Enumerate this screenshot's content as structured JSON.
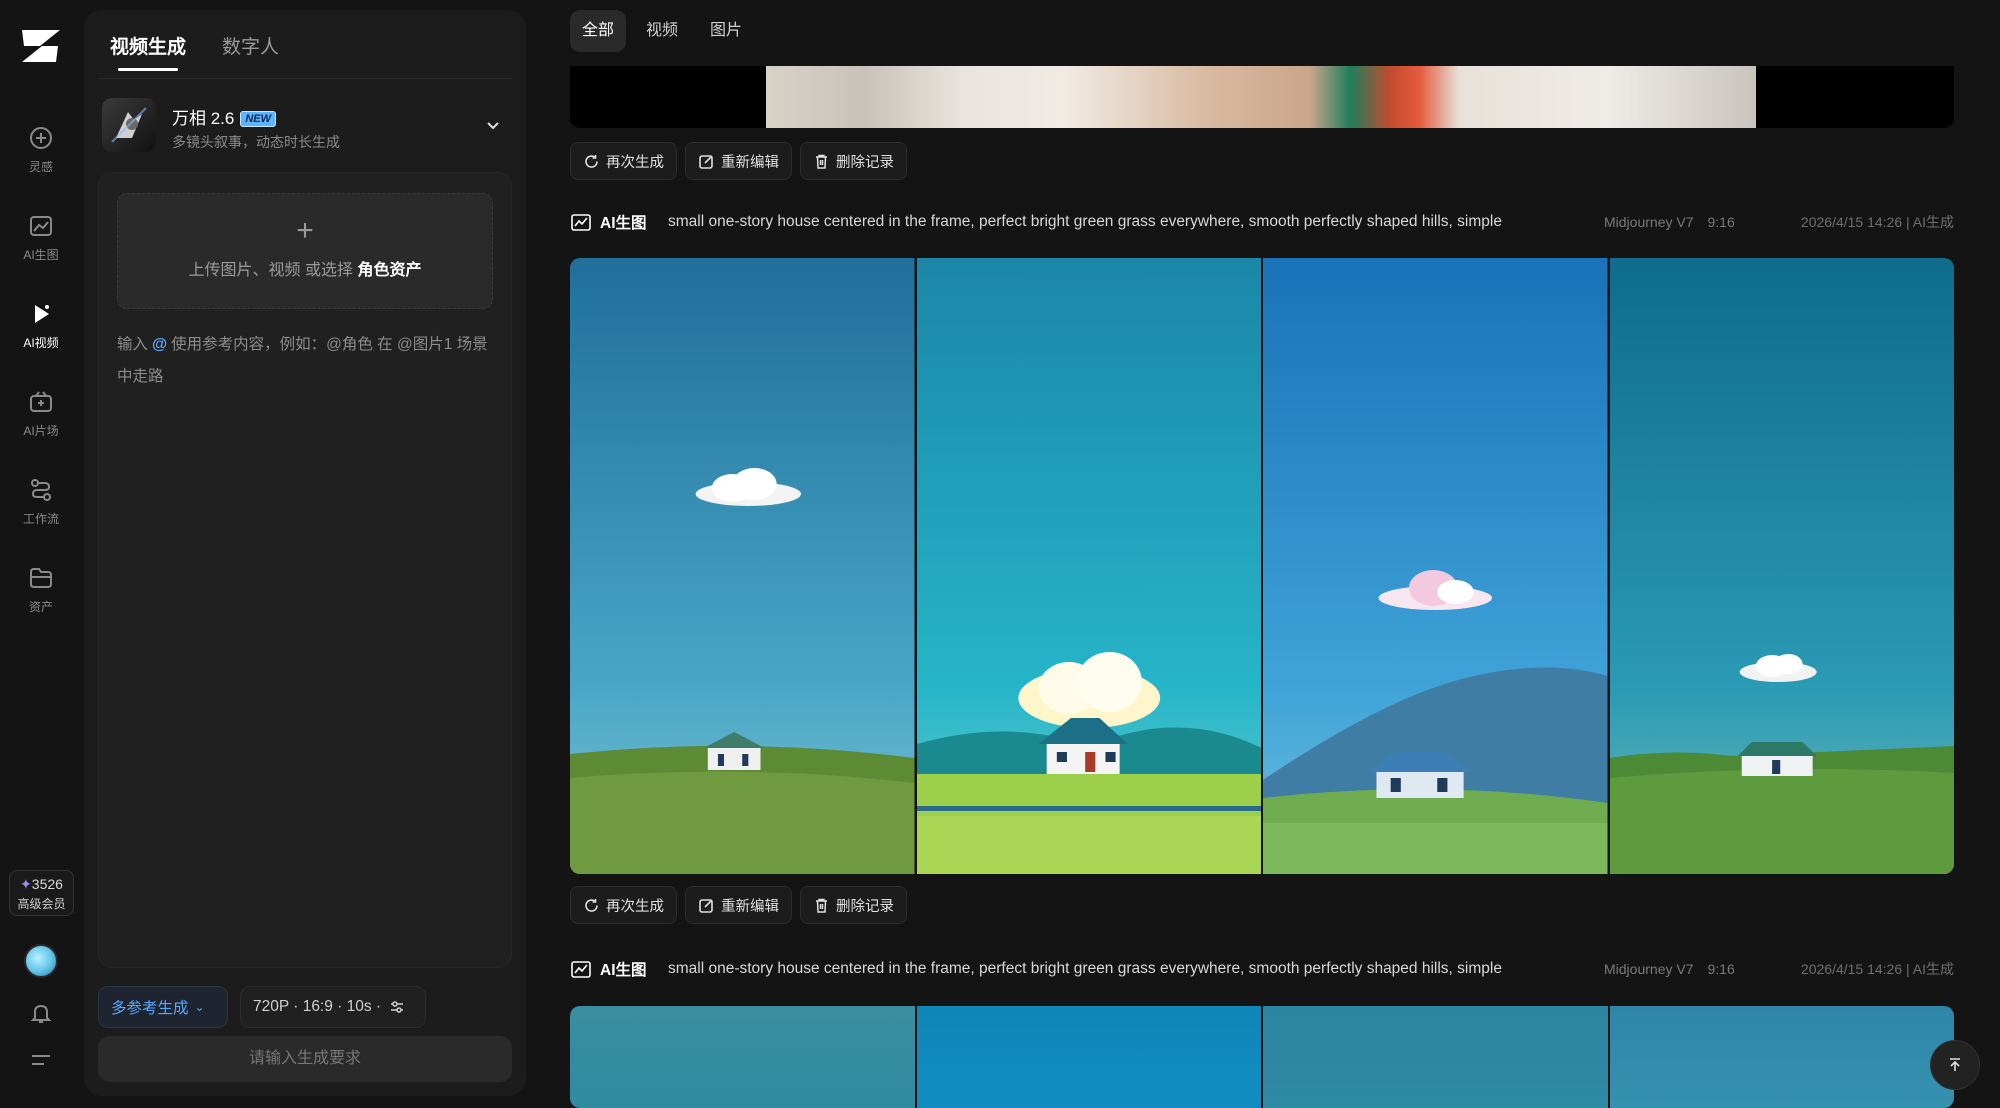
{
  "rail": {
    "items": [
      {
        "label": "灵感",
        "icon": "bulb-icon"
      },
      {
        "label": "AI生图",
        "icon": "image-chart-icon"
      },
      {
        "label": "AI视频",
        "icon": "play-icon"
      },
      {
        "label": "AI片场",
        "icon": "studio-icon"
      },
      {
        "label": "工作流",
        "icon": "workflow-icon"
      },
      {
        "label": "资产",
        "icon": "folder-icon"
      }
    ],
    "credits": "3526",
    "tier": "高级会员"
  },
  "panel": {
    "tabs": [
      "视频生成",
      "数字人"
    ],
    "model": {
      "name": "万相 2.6",
      "badge": "NEW",
      "desc": "多镜头叙事，动态时长生成"
    },
    "upload": {
      "plus": "+",
      "text": "上传图片、视频 或选择",
      "bold": "角色资产"
    },
    "input": {
      "pre": "输入",
      "at": "@",
      "post": "使用参考内容，例如：@角色 在 @图片1 场景中走路"
    },
    "ref_chip": "多参考生成",
    "spec_chip": "720P · 16:9 · 10s ·",
    "submit": "请输入生成要求"
  },
  "main": {
    "filters": [
      "全部",
      "视频",
      "图片"
    ],
    "actions": [
      "再次生成",
      "重新编辑",
      "删除记录"
    ],
    "records": [
      {
        "kind": "AI生图",
        "prompt": "small one-story house centered in the frame, perfect bright green grass everywhere, smooth perfectly shaped hills, simple",
        "model": "Midjourney V7",
        "ratio": "9:16",
        "time": "2026/4/15 14:26 | AI生成"
      },
      {
        "kind": "AI生图",
        "prompt": "small one-story house centered in the frame, perfect bright green grass everywhere, smooth perfectly shaped hills, simple",
        "model": "Midjourney V7",
        "ratio": "9:16",
        "time": "2026/4/15 14:26 | AI生成"
      }
    ]
  },
  "colors": {
    "accent": "#5aa7ff",
    "bg": "#141414",
    "panel": "#1c1c1c"
  }
}
